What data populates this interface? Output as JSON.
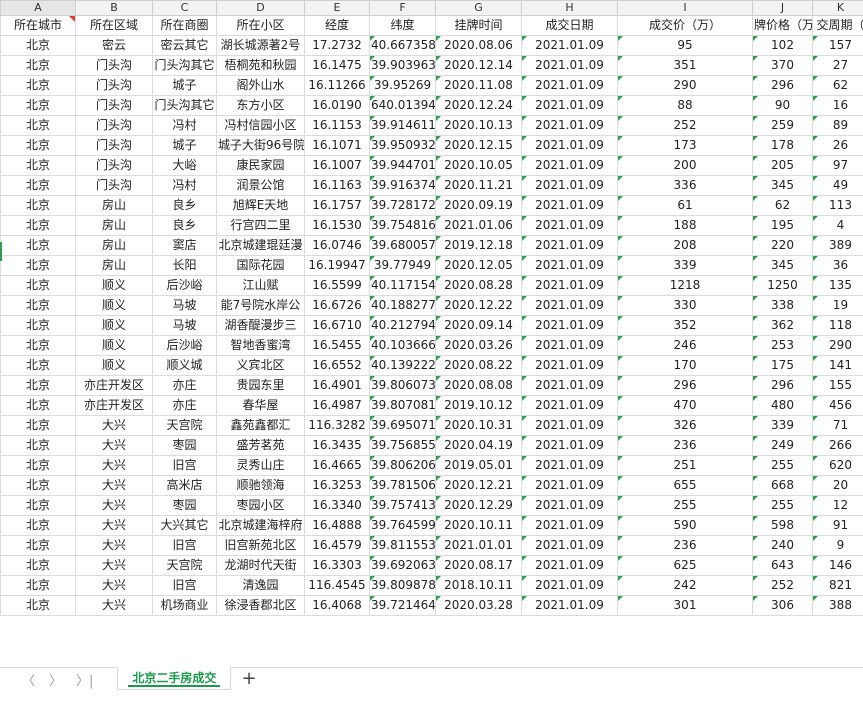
{
  "sheet": {
    "columns": [
      "A",
      "B",
      "C",
      "D",
      "E",
      "F",
      "G",
      "H",
      "I",
      "J",
      "K"
    ],
    "headers": [
      "所在城市",
      "所在区域",
      "所在商圈",
      "所在小区",
      "经度",
      "纬度",
      "挂牌时间",
      "成交日期",
      "成交价（万）",
      "牌价格（万",
      "交周期（"
    ],
    "rows": [
      [
        "北京",
        "密云",
        "密云其它",
        "湖长城源著2号",
        "17.2732",
        "40.667358",
        "2020.08.06",
        "2021.01.09",
        "95",
        "102",
        "157"
      ],
      [
        "北京",
        "门头沟",
        "门头沟其它",
        "梧桐苑和秋园",
        "16.1475",
        "39.903963",
        "2020.12.14",
        "2021.01.09",
        "351",
        "370",
        "27"
      ],
      [
        "北京",
        "门头沟",
        "城子",
        "阁外山水",
        "16.11266",
        "39.95269",
        "2020.11.08",
        "2021.01.09",
        "290",
        "296",
        "62"
      ],
      [
        "北京",
        "门头沟",
        "门头沟其它",
        "东方小区",
        "16.0190",
        "640.013942",
        "2020.12.24",
        "2021.01.09",
        "88",
        "90",
        "16"
      ],
      [
        "北京",
        "门头沟",
        "冯村",
        "冯村信园小区",
        "16.1153",
        "39.914611",
        "2020.10.13",
        "2021.01.09",
        "252",
        "259",
        "89"
      ],
      [
        "北京",
        "门头沟",
        "城子",
        "城子大街96号院",
        "16.1071",
        "39.950932",
        "2020.12.15",
        "2021.01.09",
        "173",
        "178",
        "26"
      ],
      [
        "北京",
        "门头沟",
        "大峪",
        "康民家园",
        "16.1007",
        "39.944701",
        "2020.10.05",
        "2021.01.09",
        "200",
        "205",
        "97"
      ],
      [
        "北京",
        "门头沟",
        "冯村",
        "润景公馆",
        "16.1163",
        "39.916374",
        "2020.11.21",
        "2021.01.09",
        "336",
        "345",
        "49"
      ],
      [
        "北京",
        "房山",
        "良乡",
        "旭辉E天地",
        "16.1757",
        "39.728172",
        "2020.09.19",
        "2021.01.09",
        "61",
        "62",
        "113"
      ],
      [
        "北京",
        "房山",
        "良乡",
        "行宫四二里",
        "16.1530",
        "39.754816",
        "2021.01.06",
        "2021.01.09",
        "188",
        "195",
        "4"
      ],
      [
        "北京",
        "房山",
        "窦店",
        "北京城建琨廷漫",
        "16.0746",
        "39.680057",
        "2019.12.18",
        "2021.01.09",
        "208",
        "220",
        "389"
      ],
      [
        "北京",
        "房山",
        "长阳",
        "国际花园",
        "16.19947",
        "39.77949",
        "2020.12.05",
        "2021.01.09",
        "339",
        "345",
        "36"
      ],
      [
        "北京",
        "顺义",
        "后沙峪",
        "江山赋",
        "16.5599",
        "40.117154",
        "2020.08.28",
        "2021.01.09",
        "1218",
        "1250",
        "135"
      ],
      [
        "北京",
        "顺义",
        "马坡",
        "能7号院水岸公",
        "16.6726",
        "40.188277",
        "2020.12.22",
        "2021.01.09",
        "330",
        "338",
        "19"
      ],
      [
        "北京",
        "顺义",
        "马坡",
        "湖香醍漫步三",
        "16.6710",
        "40.212794",
        "2020.09.14",
        "2021.01.09",
        "352",
        "362",
        "118"
      ],
      [
        "北京",
        "顺义",
        "后沙峪",
        "智地香蜜湾",
        "16.5455",
        "40.103666",
        "2020.03.26",
        "2021.01.09",
        "246",
        "253",
        "290"
      ],
      [
        "北京",
        "顺义",
        "顺义城",
        "义宾北区",
        "16.6552",
        "40.139222",
        "2020.08.22",
        "2021.01.09",
        "170",
        "175",
        "141"
      ],
      [
        "北京",
        "亦庄开发区",
        "亦庄",
        "贵园东里",
        "16.4901",
        "39.806073",
        "2020.08.08",
        "2021.01.09",
        "296",
        "296",
        "155"
      ],
      [
        "北京",
        "亦庄开发区",
        "亦庄",
        "春华屋",
        "16.4987",
        "39.807081",
        "2019.10.12",
        "2021.01.09",
        "470",
        "480",
        "456"
      ],
      [
        "北京",
        "大兴",
        "天宫院",
        "鑫苑鑫都汇",
        "116.3282",
        "39.695071",
        "2020.10.31",
        "2021.01.09",
        "326",
        "339",
        "71"
      ],
      [
        "北京",
        "大兴",
        "枣园",
        "盛芳茗苑",
        "16.3435",
        "39.756855",
        "2020.04.19",
        "2021.01.09",
        "236",
        "249",
        "266"
      ],
      [
        "北京",
        "大兴",
        "旧宫",
        "灵秀山庄",
        "16.4665",
        "39.806206",
        "2019.05.01",
        "2021.01.09",
        "251",
        "255",
        "620"
      ],
      [
        "北京",
        "大兴",
        "高米店",
        "顺驰领海",
        "16.3253",
        "39.781506",
        "2020.12.21",
        "2021.01.09",
        "655",
        "668",
        "20"
      ],
      [
        "北京",
        "大兴",
        "枣园",
        "枣园小区",
        "16.3340",
        "39.757413",
        "2020.12.29",
        "2021.01.09",
        "255",
        "255",
        "12"
      ],
      [
        "北京",
        "大兴",
        "大兴其它",
        "北京城建海梓府",
        "16.4888",
        "39.764599",
        "2020.10.11",
        "2021.01.09",
        "590",
        "598",
        "91"
      ],
      [
        "北京",
        "大兴",
        "旧宫",
        "旧宫新苑北区",
        "16.4579",
        "39.811553",
        "2021.01.01",
        "2021.01.09",
        "236",
        "240",
        "9"
      ],
      [
        "北京",
        "大兴",
        "天宫院",
        "龙湖时代天街",
        "16.3303",
        "39.692063",
        "2020.08.17",
        "2021.01.09",
        "625",
        "643",
        "146"
      ],
      [
        "北京",
        "大兴",
        "旧宫",
        "清逸园",
        "116.4545",
        "39.809878",
        "2018.10.11",
        "2021.01.09",
        "242",
        "252",
        "821"
      ],
      [
        "北京",
        "大兴",
        "机场商业",
        "徐浸香郡北区",
        "16.4068",
        "39.721464",
        "2020.03.28",
        "2021.01.09",
        "301",
        "306",
        "388"
      ]
    ]
  },
  "tabbar": {
    "nav": [
      "〈",
      "〉",
      "〉|"
    ],
    "active_sheet": "北京二手房成交",
    "add_label": "+"
  },
  "colors": {
    "accent": "#1a9a4a",
    "grid": "#dcdcdc",
    "marker": "#e03c31"
  }
}
